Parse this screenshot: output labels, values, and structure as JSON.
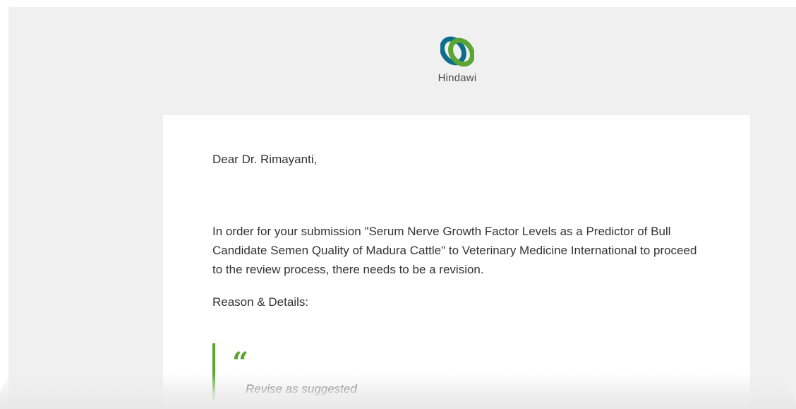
{
  "logo": {
    "text": "Hindawi",
    "icon": "hindawi-logo-icon",
    "colors": {
      "teal": "#0c6e8a",
      "green": "#5ba532"
    }
  },
  "email": {
    "greeting": "Dear Dr. Rimayanti,",
    "body": "In order for your submission \"Serum Nerve Growth Factor Levels as a Predictor of Bull Candidate Semen Quality of Madura Cattle\" to Veterinary Medicine International to proceed to the review process, there needs to be a revision.",
    "reason_label": "Reason & Details:",
    "quote_mark": "“",
    "quote_text": "Revise as suggested"
  },
  "colors": {
    "page_background": "#f0f0f0",
    "card_background": "#ffffff",
    "accent": "#5ba532",
    "text": "#333333"
  }
}
